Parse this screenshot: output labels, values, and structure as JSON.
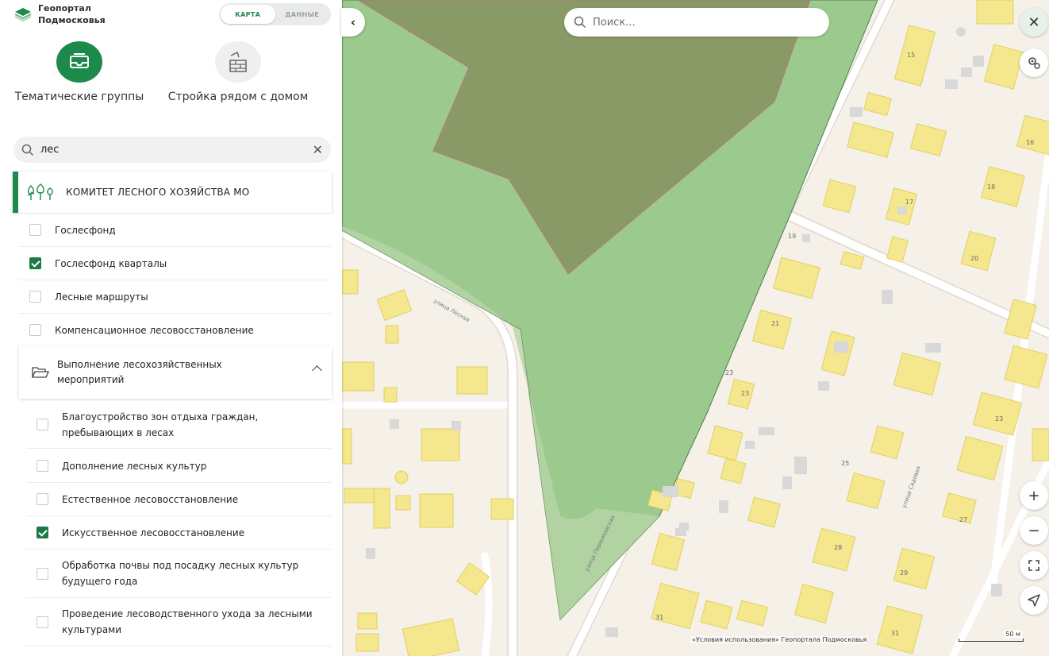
{
  "app": {
    "title_line1": "Геопортал",
    "title_line2": "Подмосковья"
  },
  "mode_toggle": {
    "map": "КАРТА",
    "data": "ДАННЫЕ"
  },
  "categories": [
    {
      "label": "Тематические группы",
      "icon": "thematic-groups-icon"
    },
    {
      "label": "Стройка рядом с домом",
      "icon": "construction-icon"
    }
  ],
  "layer_search": {
    "value": "лес"
  },
  "organization": {
    "label": "КОМИТЕТ ЛЕСНОГО ХОЗЯЙСТВА МО"
  },
  "layers": [
    {
      "label": "Гослесфонд",
      "checked": false
    },
    {
      "label": "Гослесфонд кварталы",
      "checked": true
    },
    {
      "label": "Лесные маршруты",
      "checked": false
    },
    {
      "label": "Компенсационное лесовосстановление",
      "checked": false
    }
  ],
  "group": {
    "label": "Выполнение лесохозяйственных мероприятий",
    "expanded": true
  },
  "sublayers": [
    {
      "label": "Благоустройство зон отдыха граждан, пребывающих в лесах",
      "checked": false
    },
    {
      "label": "Дополнение лесных культур",
      "checked": false
    },
    {
      "label": "Естественное лесовосстановление",
      "checked": false
    },
    {
      "label": "Искусственное лесовосстановление",
      "checked": true
    },
    {
      "label": "Обработка почвы под посадку лесных культур будущего года",
      "checked": false
    },
    {
      "label": "Проведение лесоводственного ухода за лесными культурами",
      "checked": false
    }
  ],
  "map": {
    "search_placeholder": "Поиск...",
    "terms": "«Условия использования» Геопортала Подмосковья",
    "scale_label": "50 м",
    "street_labels": [
      "улица Лесная",
      "улица Садовая",
      "улица Первомайская"
    ],
    "house_numbers": [
      "15",
      "16",
      "17",
      "18",
      "19",
      "20",
      "21",
      "23",
      "23",
      "23",
      "25",
      "27",
      "28",
      "29",
      "31",
      "31"
    ],
    "colors": {
      "forest": "#9cc98e",
      "forest_dark": "#8a9a66",
      "building": "#f4e78d",
      "ground": "#f5f1e8",
      "accent": "#1d8a4b"
    }
  }
}
